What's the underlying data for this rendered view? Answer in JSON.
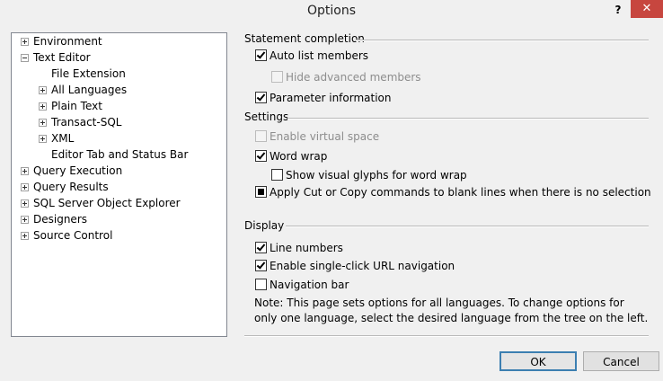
{
  "window": {
    "title": "Options",
    "help_label": "?",
    "close_label": "✕"
  },
  "tree": {
    "items": [
      {
        "label": "Environment",
        "expander": "plus"
      },
      {
        "label": "Text Editor",
        "expander": "minus"
      },
      {
        "label": "File Extension",
        "expander": "none"
      },
      {
        "label": "All Languages",
        "expander": "plus"
      },
      {
        "label": "Plain Text",
        "expander": "plus"
      },
      {
        "label": "Transact-SQL",
        "expander": "plus"
      },
      {
        "label": "XML",
        "expander": "plus"
      },
      {
        "label": "Editor Tab and Status Bar",
        "expander": "none"
      },
      {
        "label": "Query Execution",
        "expander": "plus"
      },
      {
        "label": "Query Results",
        "expander": "plus"
      },
      {
        "label": "SQL Server Object Explorer",
        "expander": "plus"
      },
      {
        "label": "Designers",
        "expander": "plus"
      },
      {
        "label": "Source Control",
        "expander": "plus"
      }
    ]
  },
  "statement_completion": {
    "heading": "Statement completion",
    "auto_list_members": {
      "label": "Auto list members",
      "checked": true,
      "enabled": true
    },
    "hide_advanced_members": {
      "label": "Hide advanced members",
      "checked": false,
      "enabled": false
    },
    "parameter_information": {
      "label": "Parameter information",
      "checked": true,
      "enabled": true
    }
  },
  "settings": {
    "heading": "Settings",
    "enable_virtual_space": {
      "label": "Enable virtual space",
      "checked": false,
      "enabled": false
    },
    "word_wrap": {
      "label": "Word wrap",
      "checked": true,
      "enabled": true
    },
    "show_visual_glyphs": {
      "label": "Show visual glyphs for word wrap",
      "checked": false,
      "enabled": true
    },
    "apply_cut_copy": {
      "label": "Apply Cut or Copy commands to blank lines when there is no selection",
      "state": "indeterminate",
      "enabled": true
    }
  },
  "display": {
    "heading": "Display",
    "line_numbers": {
      "label": "Line numbers",
      "checked": true,
      "enabled": true
    },
    "single_click_url": {
      "label": "Enable single-click URL navigation",
      "checked": true,
      "enabled": true
    },
    "navigation_bar": {
      "label": "Navigation bar",
      "checked": false,
      "enabled": true
    }
  },
  "note": "Note: This page sets options for all languages. To change options for only one language, select the desired language from the tree on the left.",
  "buttons": {
    "ok": "OK",
    "cancel": "Cancel"
  }
}
